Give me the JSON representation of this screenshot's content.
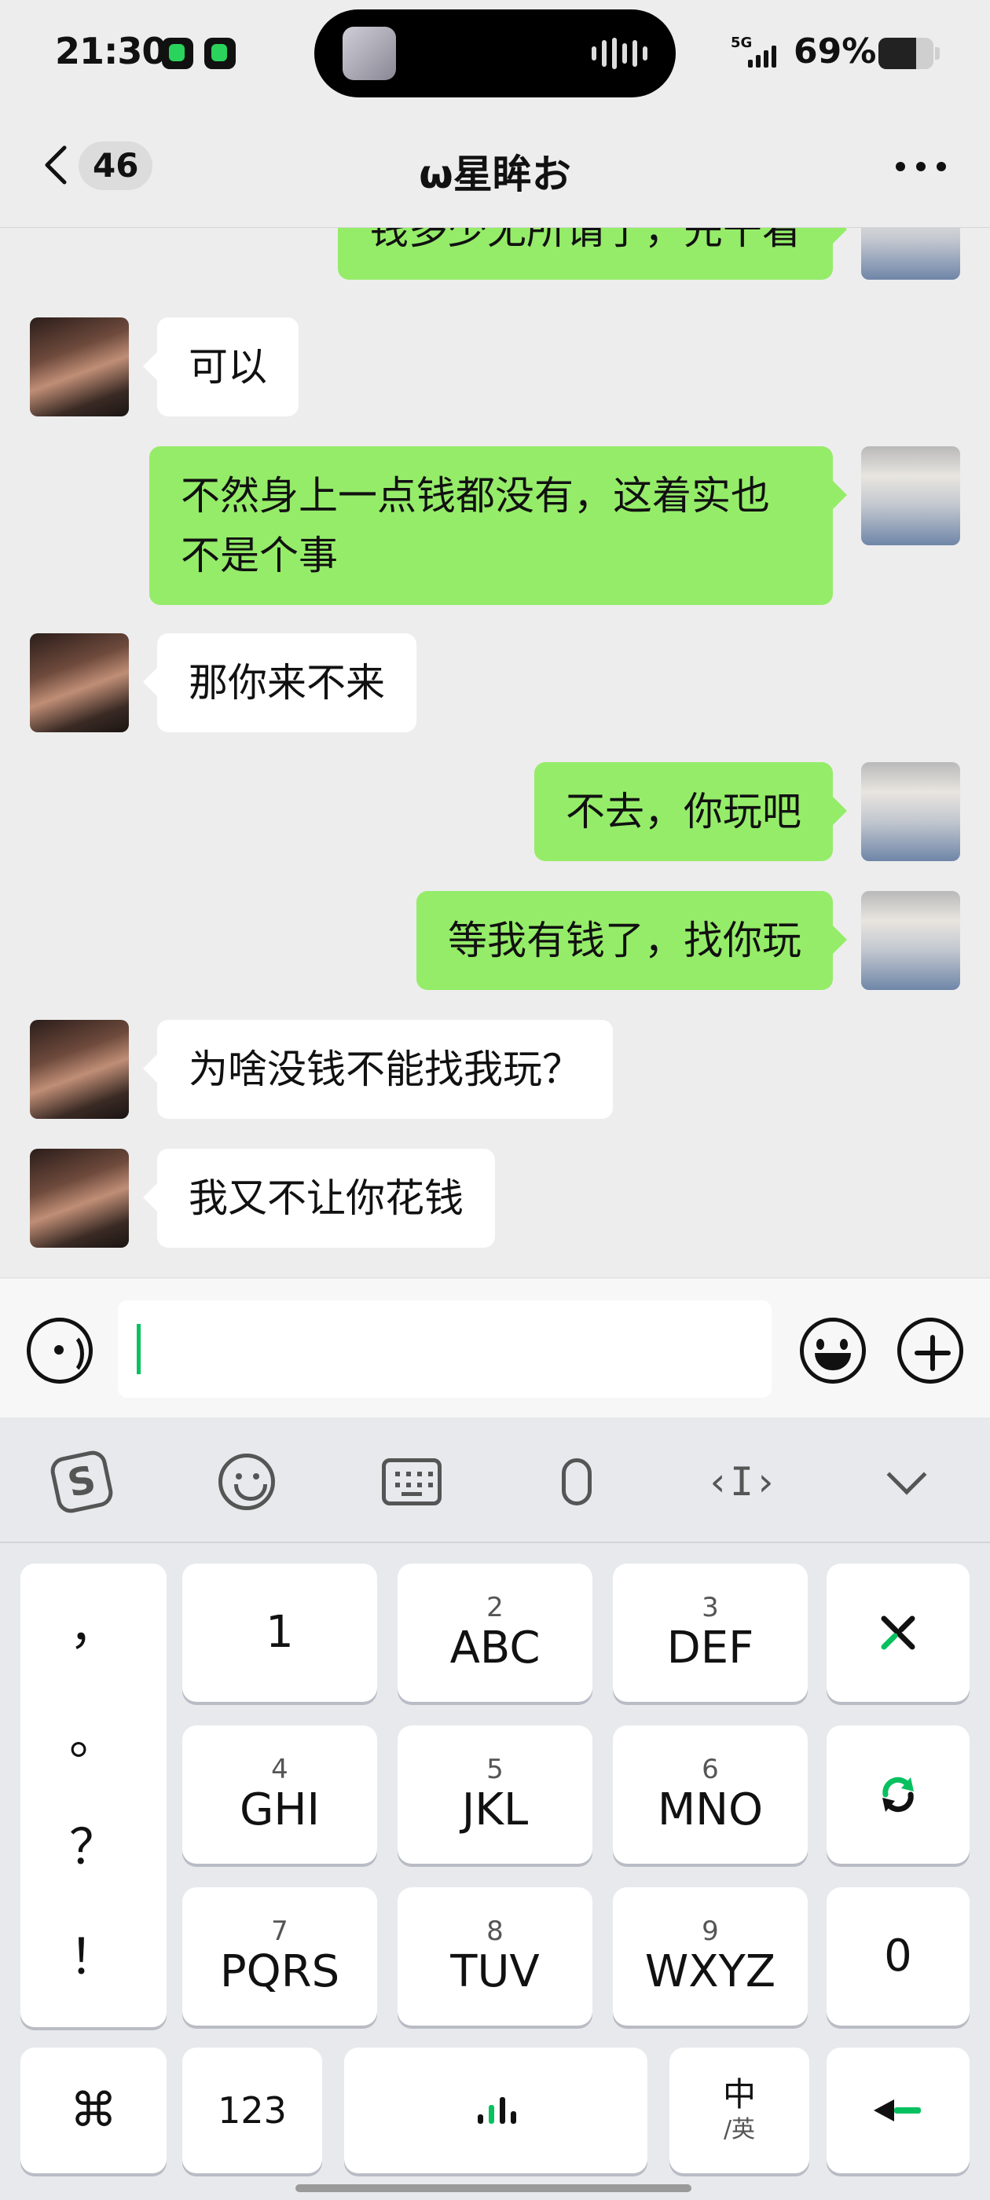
{
  "status_bar": {
    "time": "21:30",
    "network": "5G",
    "battery_percent": "69%",
    "battery_level": 0.69
  },
  "header": {
    "unread_count": "46",
    "title": "ω星眸お"
  },
  "messages": [
    {
      "side": "right",
      "text": "钱多少无所谓了，先干看"
    },
    {
      "side": "left",
      "text": "可以"
    },
    {
      "side": "right",
      "text": "不然身上一点钱都没有，这着实也不是个事"
    },
    {
      "side": "left",
      "text": "那你来不来"
    },
    {
      "side": "right",
      "text": "不去，你玩吧"
    },
    {
      "side": "right",
      "text": "等我有钱了，找你玩"
    },
    {
      "side": "left",
      "text": "为啥没钱不能找我玩？"
    },
    {
      "side": "left",
      "text": "我又不让你花钱"
    }
  ],
  "input": {
    "value": ""
  },
  "keyboard": {
    "punctuation": [
      "，",
      "。",
      "？",
      "！"
    ],
    "keys": [
      {
        "sub": "",
        "main": "1"
      },
      {
        "sub": "2",
        "main": "ABC"
      },
      {
        "sub": "3",
        "main": "DEF"
      },
      {
        "sub": "4",
        "main": "GHI"
      },
      {
        "sub": "5",
        "main": "JKL"
      },
      {
        "sub": "6",
        "main": "MNO"
      },
      {
        "sub": "7",
        "main": "PQRS"
      },
      {
        "sub": "8",
        "main": "TUV"
      },
      {
        "sub": "9",
        "main": "WXYZ"
      }
    ],
    "zero": "0",
    "numbers": "123",
    "lang_main": "中",
    "lang_sub": "/英"
  }
}
